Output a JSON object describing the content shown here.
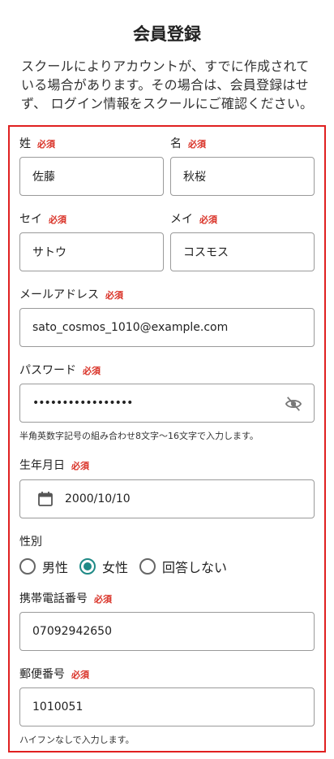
{
  "header": {
    "title": "会員登録",
    "intro": "スクールによりアカウントが、すでに作成されている場合があります。その場合は、会員登録はせず、 ログイン情報をスクールにご確認ください。"
  },
  "required_label": "必須",
  "fields": {
    "last_name": {
      "label": "姓",
      "value": "佐藤"
    },
    "first_name": {
      "label": "名",
      "value": "秋桜"
    },
    "last_name_kana": {
      "label": "セイ",
      "value": "サトウ"
    },
    "first_name_kana": {
      "label": "メイ",
      "value": "コスモス"
    },
    "email": {
      "label": "メールアドレス",
      "value": "sato_cosmos_1010@example.com"
    },
    "password": {
      "label": "パスワード",
      "masked_value": "•••••••••••••••••",
      "helper": "半角英数字記号の組み合わせ8文字〜16文字で入力します。",
      "toggle_icon": "eye-off-icon"
    },
    "birthdate": {
      "label": "生年月日",
      "value": "2000/10/10",
      "icon": "calendar-icon"
    },
    "gender": {
      "label": "性別",
      "options": [
        "男性",
        "女性",
        "回答しない"
      ],
      "selected": "女性",
      "accent_color": "#1f8a86"
    },
    "mobile": {
      "label": "携帯電話番号",
      "value": "07092942650"
    },
    "postal_code": {
      "label": "郵便番号",
      "value": "1010051",
      "helper": "ハイフンなしで入力します。"
    }
  },
  "colors": {
    "required": "#d93025",
    "frame_border": "#e02020",
    "radio_accent": "#1f8a86"
  }
}
